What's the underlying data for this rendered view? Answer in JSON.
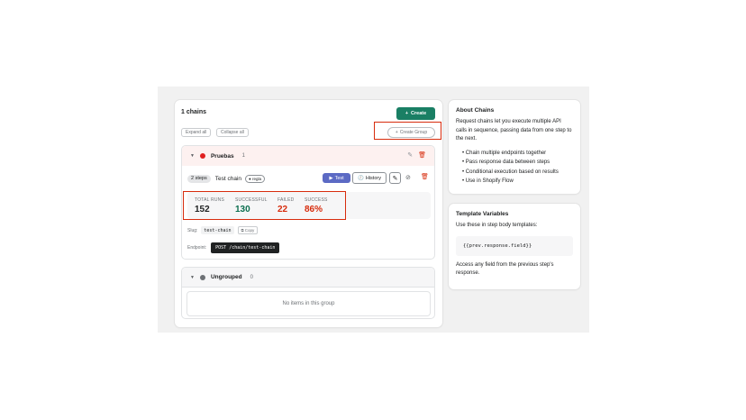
{
  "header": {
    "chains_count": "1 chains",
    "create_label": "Create",
    "expand_all": "Expand all",
    "collapse_all": "Collapse all",
    "create_group": "Create Group"
  },
  "groups": [
    {
      "name": "Pruebas",
      "count": "1",
      "color": "#e02020",
      "chain": {
        "steps": "2 steps",
        "name": "Test chain",
        "tag": "regla",
        "test_label": "Test",
        "history_label": "History",
        "stats": [
          {
            "label": "TOTAL RUNS",
            "value": "152",
            "color": "#202223"
          },
          {
            "label": "SUCCESSFUL",
            "value": "130",
            "color": "#0b6e4f"
          },
          {
            "label": "FAILED",
            "value": "22",
            "color": "#d72c0d"
          },
          {
            "label": "SUCCESS",
            "value": "86%",
            "color": "#d72c0d"
          }
        ],
        "slug_label": "Slug:",
        "slug": "test-chain",
        "copy_label": "Copy",
        "endpoint_label": "Endpoint:",
        "endpoint": "POST /chain/test-chain"
      }
    },
    {
      "name": "Ungrouped",
      "count": "0",
      "color": "#6d7175",
      "empty_text": "No items in this group"
    }
  ],
  "about": {
    "title": "About Chains",
    "description": "Request chains let you execute multiple API calls in sequence, passing data from one step to the next.",
    "features": [
      "Chain multiple endpoints together",
      "Pass response data between steps",
      "Conditional execution based on results",
      "Use in Shopify Flow"
    ]
  },
  "template_vars": {
    "title": "Template Variables",
    "intro": "Use these in step body templates:",
    "code": "{{prev.response.field}}",
    "footer": "Access any field from the previous step's response."
  },
  "colors": {
    "primary": "#1a7f64",
    "accent": "#5c6ac4",
    "critical": "#d72c0d"
  }
}
